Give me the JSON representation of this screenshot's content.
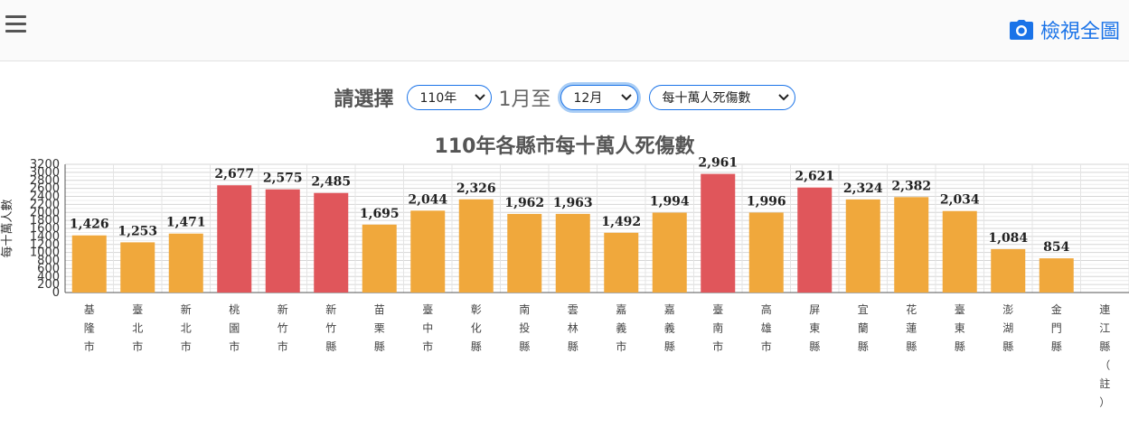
{
  "header": {
    "menu_icon": "hamburger-icon",
    "view_full_label": "檢視全圖",
    "view_full_icon": "camera-icon",
    "accent_color": "#1a73e8"
  },
  "controls": {
    "prompt_label": "請選擇",
    "year_value": "110年",
    "range_text": "1月至",
    "month_value": "12月",
    "metric_value": "每十萬人死傷數"
  },
  "chart_data": {
    "type": "bar",
    "title": "110年各縣市每十萬人死傷數",
    "ylabel": "每十萬人數",
    "ylim": [
      0,
      3200
    ],
    "y_ticks": [
      0,
      200,
      400,
      600,
      800,
      1000,
      1200,
      1400,
      1600,
      1800,
      2000,
      2200,
      2400,
      2600,
      2800,
      3000,
      3200
    ],
    "grid": true,
    "categories": [
      "基隆市",
      "臺北市",
      "新北市",
      "桃園市",
      "新竹市",
      "新竹縣",
      "苗栗縣",
      "臺中市",
      "彰化縣",
      "南投縣",
      "雲林縣",
      "嘉義市",
      "嘉義縣",
      "臺南市",
      "高雄市",
      "屏東縣",
      "宜蘭縣",
      "花蓮縣",
      "臺東縣",
      "澎湖縣",
      "金門縣",
      "連江縣（註）"
    ],
    "values": [
      1426,
      1253,
      1471,
      2677,
      2575,
      2485,
      1695,
      2044,
      2326,
      1962,
      1963,
      1492,
      1994,
      2961,
      1996,
      2621,
      2324,
      2382,
      2034,
      1084,
      854,
      null
    ],
    "value_labels": [
      "1,426",
      "1,253",
      "1,471",
      "2,677",
      "2,575",
      "2,485",
      "1,695",
      "2,044",
      "2,326",
      "1,962",
      "1,963",
      "1,492",
      "1,994",
      "2,961",
      "1,996",
      "2,621",
      "2,324",
      "2,382",
      "2,034",
      "1,084",
      "854",
      ""
    ],
    "highlight": [
      false,
      false,
      false,
      true,
      true,
      true,
      false,
      false,
      false,
      false,
      false,
      false,
      false,
      true,
      false,
      true,
      false,
      false,
      false,
      false,
      false,
      false
    ],
    "colors": {
      "normal": "#f0a83c",
      "highlight": "#e0565b"
    }
  }
}
